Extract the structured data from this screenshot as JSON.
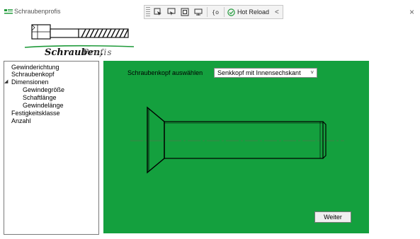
{
  "window": {
    "title": "Schraubenprofis",
    "close_glyph": "×"
  },
  "toolbar": {
    "hot_reload_label": "Hot Reload",
    "collapse_glyph": "<",
    "icons": [
      "select-element-icon",
      "display-layout-adorners-icon",
      "track-focus-icon",
      "binding-failures-icon",
      "hot-reload-status-icon"
    ]
  },
  "logo": {
    "text_main": "Schrauben.",
    "text_suffix": "Profis",
    "accent_color": "#1f9a3a"
  },
  "tree": {
    "items": [
      {
        "label": "Gewinderichtung"
      },
      {
        "label": "Schraubenkopf"
      },
      {
        "label": "Dimensionen",
        "expanded": true,
        "children": [
          {
            "label": "Gewindegröße"
          },
          {
            "label": "Schaftlänge"
          },
          {
            "label": "Gewindelänge"
          }
        ]
      },
      {
        "label": "Festigkeitsklasse"
      },
      {
        "label": "Anzahl"
      }
    ]
  },
  "panel": {
    "background_color": "#14a03e",
    "head_label": "Schraubenkopf auswählen",
    "head_select": {
      "value": "Senkkopf mit Innensechskant",
      "chevron": "˅"
    },
    "next_button_label": "Weiter"
  }
}
